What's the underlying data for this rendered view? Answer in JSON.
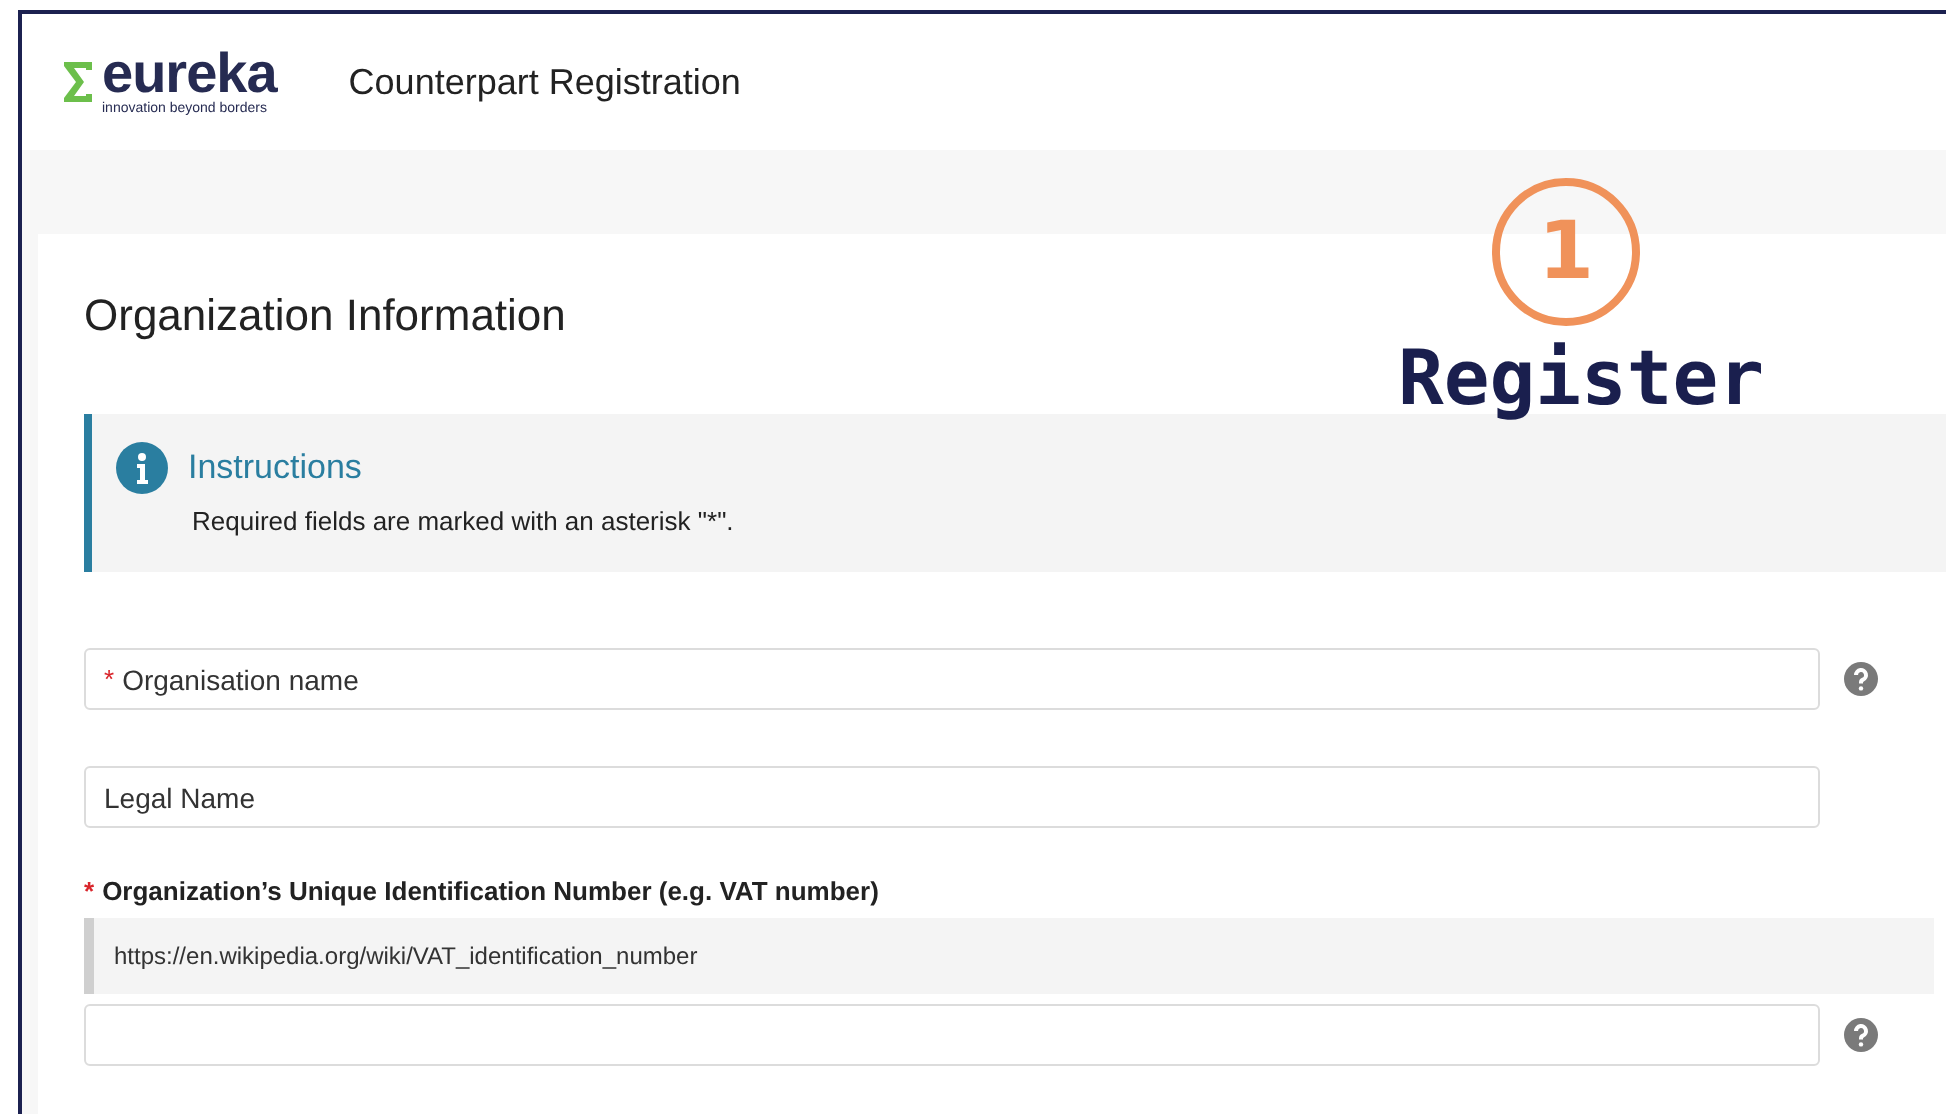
{
  "header": {
    "logo": {
      "wordmark": "eureka",
      "tagline": "innovation beyond borders"
    },
    "title": "Counterpart Registration"
  },
  "annotation": {
    "step": "1",
    "label": "Register"
  },
  "required_mark": "*",
  "section": {
    "title": "Organization Information",
    "notice": {
      "title": "Instructions",
      "text": "Required fields are marked with an asterisk \"*\"."
    },
    "fields": [
      {
        "kind": "input",
        "placeholder": "Organisation name",
        "required": true,
        "help": true
      },
      {
        "kind": "input",
        "placeholder": "Legal Name",
        "required": false,
        "help": false
      },
      {
        "kind": "labeled",
        "label": "Organization’s Unique Identification Number (e.g. VAT number)",
        "required": true,
        "hint": "https://en.wikipedia.org/wiki/VAT_identification_number",
        "help": true
      }
    ]
  }
}
